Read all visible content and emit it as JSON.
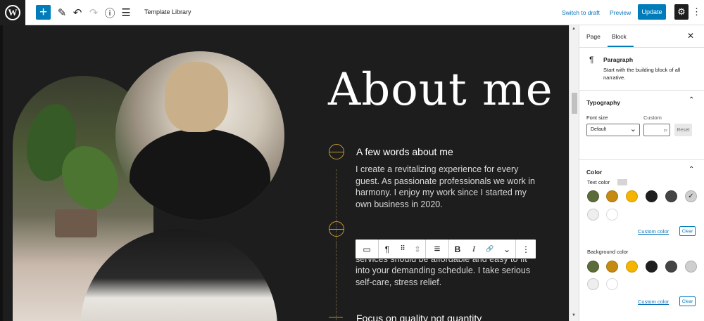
{
  "toolbar": {
    "logo": "W",
    "add_icon": "+",
    "edit_icon": "✎",
    "undo_icon": "↶",
    "redo_icon": "↷",
    "info_icon": "ⓘ",
    "outline_icon": "☰",
    "document_title": "Template Library",
    "switch_to_draft": "Switch to draft",
    "preview": "Preview",
    "update": "Update",
    "settings_icon": "⚙",
    "more_icon": "⋮"
  },
  "canvas": {
    "heading": "About me",
    "sections": [
      {
        "title": "A few words about me",
        "text": "I create a revitalizing experience for every guest. As passionate professionals we work in harmony. I enjoy my work since I started my own business in 2020."
      },
      {
        "title": "",
        "text": "My philosophy is simple. Massage and facial services should be affordable and easy to fit into your demanding schedule. I take serious self-care, stress relief."
      },
      {
        "title": "Focus on quality not quantity",
        "text": ""
      }
    ],
    "block_toolbar": {
      "transform_icon": "▭",
      "paragraph_icon": "¶",
      "drag_icon": "⠿",
      "move_icon": "⇕",
      "align_icon": "≡",
      "bold": "B",
      "italic": "I",
      "link_icon": "🔗",
      "more_dropdown_icon": "⌄",
      "options_icon": "⋮"
    }
  },
  "sidebar": {
    "tabs": [
      "Page",
      "Block"
    ],
    "active_tab": "Block",
    "close_icon": "✕",
    "block": {
      "icon": "¶",
      "name": "Paragraph",
      "description": "Start with the building block of all narrative."
    },
    "typography": {
      "title": "Typography",
      "font_size_label": "Font size",
      "custom_label": "Custom",
      "font_size_value": "Default",
      "custom_unit": "px",
      "reset": "Reset"
    },
    "color": {
      "title": "Color",
      "text_color_label": "Text color",
      "background_color_label": "Background color",
      "custom_color": "Custom color",
      "clear": "Clear",
      "palette": [
        "#5b6b3a",
        "#c48a12",
        "#f4b400",
        "#1e1e1e",
        "#444444",
        "#cfcfcf",
        "#eeeeee",
        "#ffffff"
      ],
      "selected_text_color": "#cfcfcf"
    }
  }
}
